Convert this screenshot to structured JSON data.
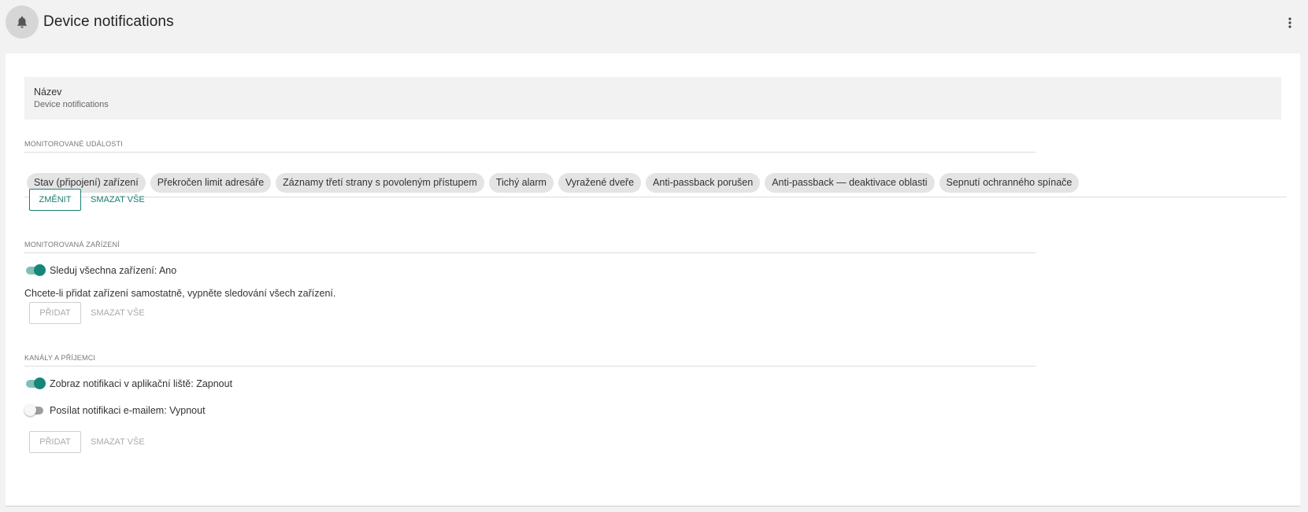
{
  "header": {
    "title": "Device notifications",
    "icon": "bell-icon",
    "menu_icon": "more-vert-icon"
  },
  "name_field": {
    "label": "Název",
    "value": "Device notifications"
  },
  "events_section": {
    "title": "Monitorované události",
    "chips": [
      "Stav (připojení) zařízení",
      "Překročen limit adresáře",
      "Záznamy třetí strany s povoleným přístupem",
      "Tichý alarm",
      "Vyražené dveře",
      "Anti-passback porušen",
      "Anti-passback — deaktivace oblasti",
      "Sepnutí ochranného spínače"
    ],
    "change_label": "Změnit",
    "clear_label": "Smazat vše"
  },
  "devices_section": {
    "title": "Monitorovaná zařízení",
    "toggle_label": "Sleduj všechna zařízení: Ano",
    "toggle_on": true,
    "hint": "Chcete-li přidat zařízení samostatně, vypněte sledování všech zařízení.",
    "add_label": "Přidat",
    "clear_label": "Smazat vše"
  },
  "channels_section": {
    "title": "Kanály a příjemci",
    "app_bar_toggle_label": "Zobraz notifikaci v aplikační liště: Zapnout",
    "app_bar_toggle_on": true,
    "email_toggle_label": "Posílat notifikaci e-mailem: Vypnout",
    "email_toggle_on": false,
    "add_label": "Přidat",
    "clear_label": "Smazat vše"
  },
  "colors": {
    "accent": "#1b7d74",
    "toggle_on": "#168678",
    "background": "#f2f2f2",
    "card": "#ffffff"
  }
}
